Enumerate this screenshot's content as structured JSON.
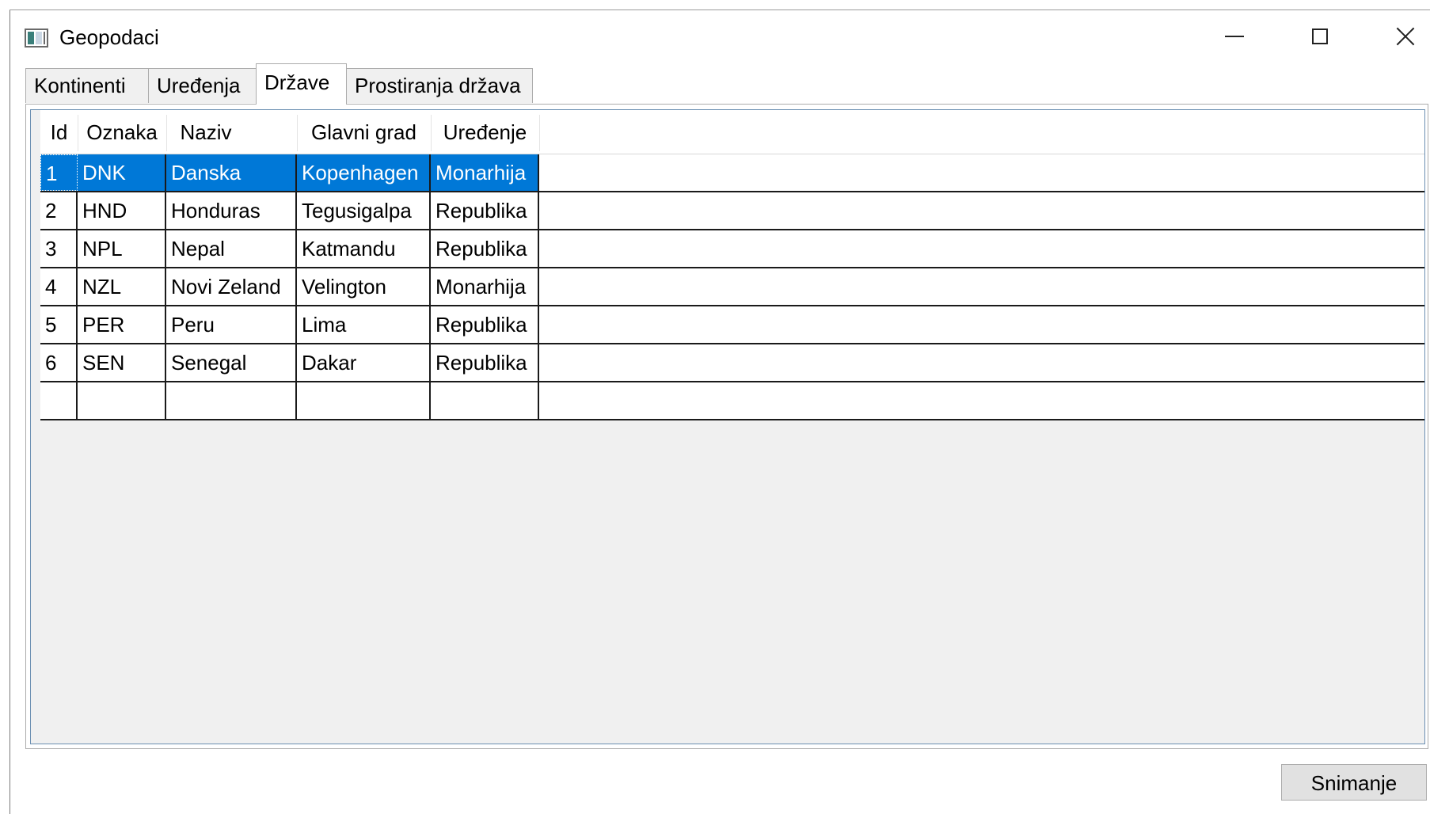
{
  "window": {
    "title": "Geopodaci"
  },
  "tabs": [
    {
      "label": "Kontinenti",
      "active": false
    },
    {
      "label": "Uređenja",
      "active": false
    },
    {
      "label": "Države",
      "active": true
    },
    {
      "label": "Prostiranja država",
      "active": false
    }
  ],
  "grid": {
    "columns": [
      "Id",
      "Oznaka",
      "Naziv",
      "Glavni grad",
      "Uređenje"
    ],
    "rows": [
      {
        "id": "1",
        "oznaka": "DNK",
        "naziv": "Danska",
        "glavni_grad": "Kopenhagen",
        "uredjenje": "Monarhija",
        "selected": true
      },
      {
        "id": "2",
        "oznaka": "HND",
        "naziv": "Honduras",
        "glavni_grad": "Tegusigalpa",
        "uredjenje": "Republika",
        "selected": false
      },
      {
        "id": "3",
        "oznaka": "NPL",
        "naziv": "Nepal",
        "glavni_grad": "Katmandu",
        "uredjenje": "Republika",
        "selected": false
      },
      {
        "id": "4",
        "oznaka": "NZL",
        "naziv": "Novi Zeland",
        "glavni_grad": "Velington",
        "uredjenje": "Monarhija",
        "selected": false
      },
      {
        "id": "5",
        "oznaka": "PER",
        "naziv": "Peru",
        "glavni_grad": "Lima",
        "uredjenje": "Republika",
        "selected": false
      },
      {
        "id": "6",
        "oznaka": "SEN",
        "naziv": "Senegal",
        "glavni_grad": "Dakar",
        "uredjenje": "Republika",
        "selected": false
      }
    ],
    "selection_color": "#0078d7"
  },
  "buttons": {
    "save_label": "Snimanje"
  },
  "icons": {
    "app": "app-window-icon",
    "minimize": "minimize-icon",
    "maximize": "maximize-icon",
    "close": "close-icon"
  }
}
